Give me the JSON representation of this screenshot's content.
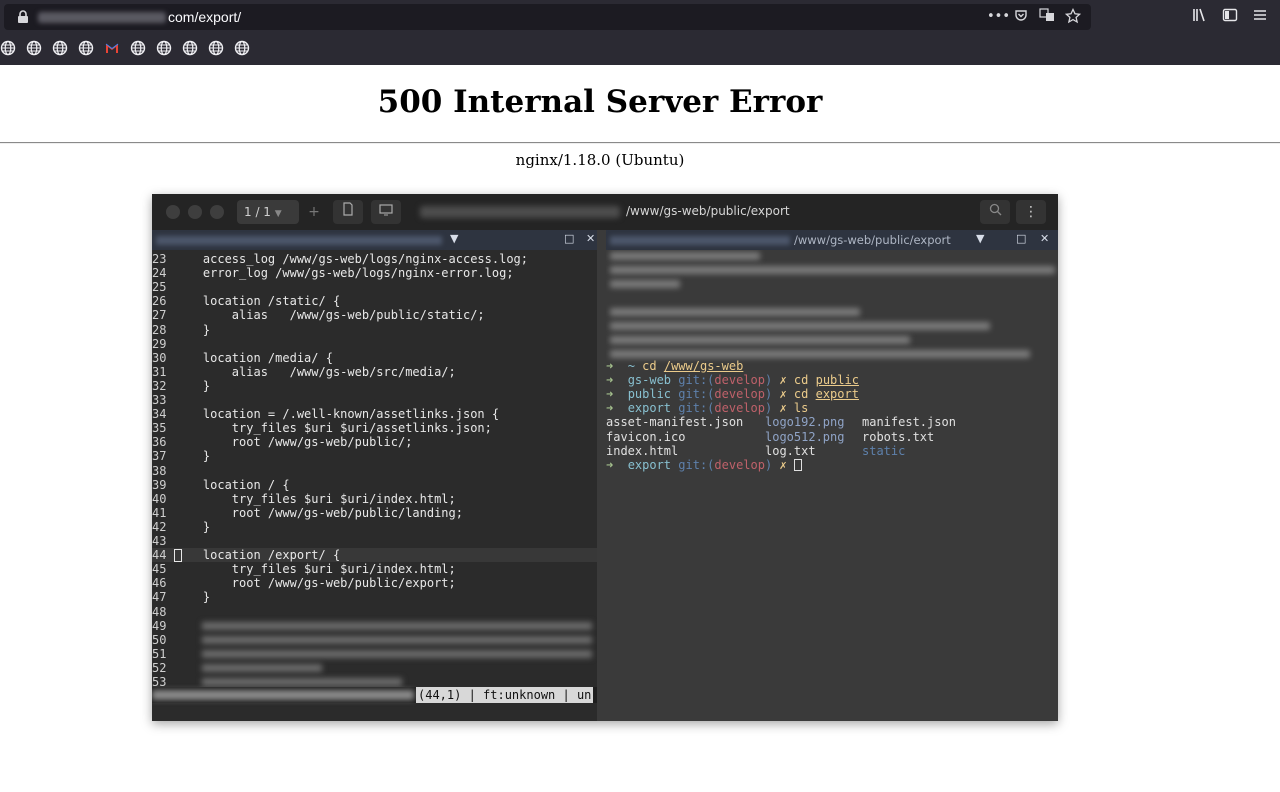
{
  "browser": {
    "url_visible": "com/export/",
    "url_icons": [
      "more-icon",
      "pocket-icon",
      "translate-icon",
      "bookmark-star-icon"
    ],
    "side_icons": [
      "library-icon",
      "sidebar-icon",
      "menu-icon"
    ],
    "bookmarks": [
      "globe-icon",
      "globe-icon",
      "globe-icon",
      "globe-icon",
      "gmail-icon",
      "globe-icon",
      "globe-icon",
      "globe-icon",
      "globe-icon",
      "globe-icon"
    ]
  },
  "page": {
    "title": "500 Internal Server Error",
    "server": "nginx/1.18.0 (Ubuntu)"
  },
  "terminal": {
    "tab_selector": "1 / 1",
    "title_path": "/www/gs-web/public/export",
    "left_pane": {
      "lines": [
        {
          "n": "23",
          "code": "    access_log /www/gs-web/logs/nginx-access.log;"
        },
        {
          "n": "24",
          "code": "    error_log /www/gs-web/logs/nginx-error.log;"
        },
        {
          "n": "25",
          "code": ""
        },
        {
          "n": "26",
          "code": "    location /static/ {"
        },
        {
          "n": "27",
          "code": "        alias   /www/gs-web/public/static/;"
        },
        {
          "n": "28",
          "code": "    }"
        },
        {
          "n": "29",
          "code": ""
        },
        {
          "n": "30",
          "code": "    location /media/ {"
        },
        {
          "n": "31",
          "code": "        alias   /www/gs-web/src/media/;"
        },
        {
          "n": "32",
          "code": "    }"
        },
        {
          "n": "33",
          "code": ""
        },
        {
          "n": "34",
          "code": "    location = /.well-known/assetlinks.json {"
        },
        {
          "n": "35",
          "code": "        try_files $uri $uri/assetlinks.json;"
        },
        {
          "n": "36",
          "code": "        root /www/gs-web/public/;"
        },
        {
          "n": "37",
          "code": "    }"
        },
        {
          "n": "38",
          "code": ""
        },
        {
          "n": "39",
          "code": "    location / {"
        },
        {
          "n": "40",
          "code": "        try_files $uri $uri/index.html;"
        },
        {
          "n": "41",
          "code": "        root /www/gs-web/public/landing;"
        },
        {
          "n": "42",
          "code": "    }"
        },
        {
          "n": "43",
          "code": ""
        },
        {
          "n": "44",
          "code": "    location /export/ {"
        },
        {
          "n": "45",
          "code": "        try_files $uri $uri/index.html;"
        },
        {
          "n": "46",
          "code": "        root /www/gs-web/public/export;"
        },
        {
          "n": "47",
          "code": "    }"
        },
        {
          "n": "48",
          "code": ""
        },
        {
          "n": "49",
          "code": ""
        },
        {
          "n": "50",
          "code": ""
        },
        {
          "n": "51",
          "code": ""
        },
        {
          "n": "52",
          "code": ""
        },
        {
          "n": "53",
          "code": ""
        }
      ],
      "status": "(44,1) | ft:unknown | un"
    },
    "right_pane": {
      "header_path": "/www/gs-web/public/export",
      "commands": [
        {
          "dir": "~",
          "git": "",
          "branch": "",
          "cmd": "cd",
          "arg": "/www/gs-web"
        },
        {
          "dir": "gs-web",
          "git": "git:(",
          "branch": "develop",
          "cmd": "cd",
          "arg": "public"
        },
        {
          "dir": "public",
          "git": "git:(",
          "branch": "develop",
          "cmd": "cd",
          "arg": "export"
        },
        {
          "dir": "export",
          "git": "git:(",
          "branch": "develop",
          "cmd": "ls",
          "arg": ""
        }
      ],
      "ls_rows": [
        [
          "asset-manifest.json",
          "logo192.png",
          "manifest.json"
        ],
        [
          "favicon.ico",
          "logo512.png",
          "robots.txt"
        ],
        [
          "index.html",
          "log.txt",
          "static"
        ]
      ],
      "final_prompt": {
        "dir": "export",
        "git": "git:(",
        "branch": "develop"
      }
    }
  }
}
